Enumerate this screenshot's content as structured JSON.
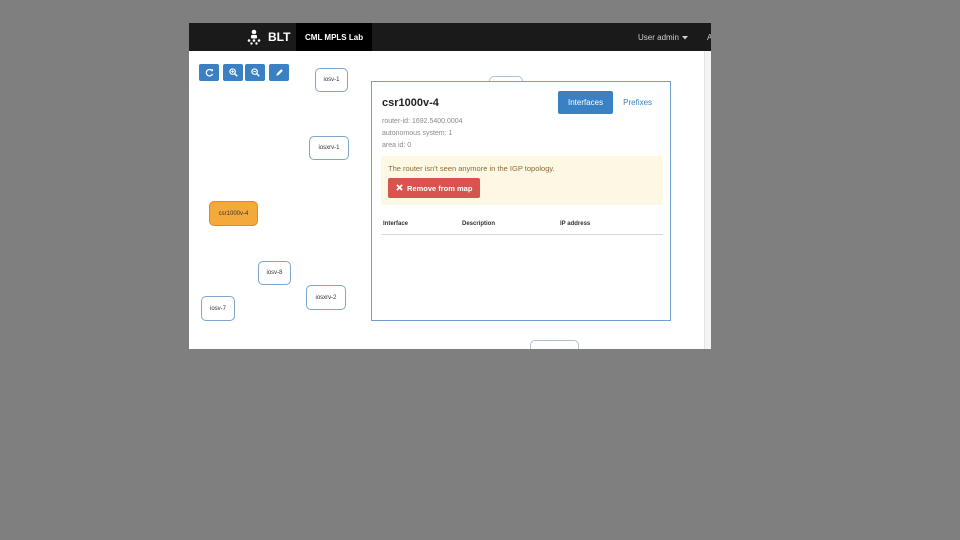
{
  "navbar": {
    "brand": "BLT",
    "lab_tab": "CML MPLS Lab",
    "user_menu": "User admin",
    "cut_item": "A"
  },
  "toolbar": {
    "buttons": [
      "refresh-icon",
      "zoom-in-icon",
      "zoom-out-icon",
      "pencil-icon"
    ]
  },
  "nodes": [
    {
      "name": "iosv-1",
      "label": "iosv-1"
    },
    {
      "name": "iosxrv-1",
      "label": "iosxrv-1"
    },
    {
      "name": "csr1000v-4",
      "label": "csr1000v-4",
      "selected": true
    },
    {
      "name": "iosv-8",
      "label": "iosv-8"
    },
    {
      "name": "iosxrv-2",
      "label": "iosxrv-2"
    },
    {
      "name": "iosv-7",
      "label": "iosv-7"
    }
  ],
  "panel": {
    "title": "csr1000v-4",
    "tabs": [
      {
        "label": "Interfaces",
        "active": true
      },
      {
        "label": "Prefixes",
        "active": false
      }
    ],
    "router_id": "router-id: 1692.5400.0004",
    "autonomous_system": "autonomous system: 1",
    "area_id": "area id: 0",
    "alert": {
      "text": "The router isn't seen anymore in the IGP topology.",
      "button_label": "Remove from map"
    },
    "table_headers": [
      "Interface",
      "Description",
      "IP address"
    ]
  },
  "colors": {
    "accent": "#3a81c3",
    "danger": "#d9534f",
    "selected_node": "#f4a93b",
    "alert_bg": "#fcf8e3",
    "navbar": "#1a1a1a"
  }
}
